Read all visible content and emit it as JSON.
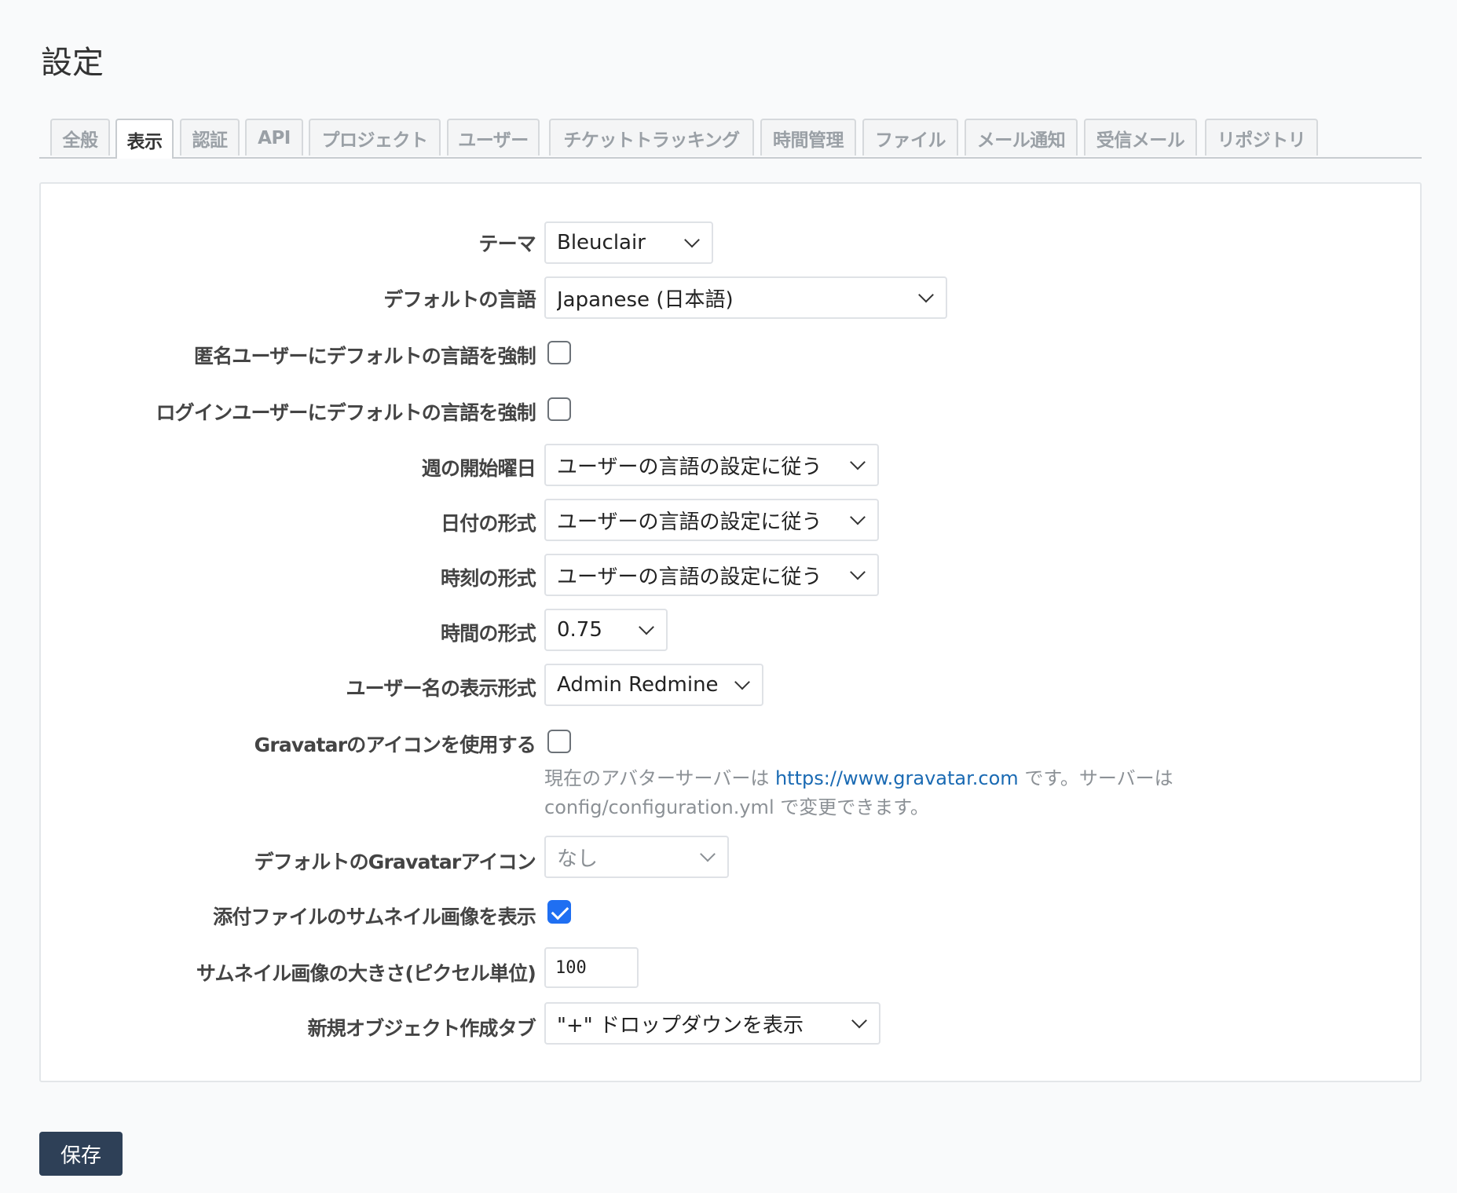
{
  "page": {
    "title": "設定"
  },
  "tabs": [
    {
      "label": "全般",
      "selected": false
    },
    {
      "label": "表示",
      "selected": true
    },
    {
      "label": "認証",
      "selected": false
    },
    {
      "label": "API",
      "selected": false
    },
    {
      "label": "プロジェクト",
      "selected": false
    },
    {
      "label": "ユーザー",
      "selected": false
    },
    {
      "label": "チケットトラッキング",
      "selected": false
    },
    {
      "label": "時間管理",
      "selected": false
    },
    {
      "label": "ファイル",
      "selected": false
    },
    {
      "label": "メール通知",
      "selected": false
    },
    {
      "label": "受信メール",
      "selected": false
    },
    {
      "label": "リポジトリ",
      "selected": false
    }
  ],
  "form": {
    "theme": {
      "label": "テーマ",
      "value": "Bleuclair"
    },
    "default_language": {
      "label": "デフォルトの言語",
      "value": "Japanese (日本語)"
    },
    "force_default_language_anonymous": {
      "label": "匿名ユーザーにデフォルトの言語を強制",
      "checked": false
    },
    "force_default_language_logged_in": {
      "label": "ログインユーザーにデフォルトの言語を強制",
      "checked": false
    },
    "start_of_week": {
      "label": "週の開始曜日",
      "value": "ユーザーの言語の設定に従う"
    },
    "date_format": {
      "label": "日付の形式",
      "value": "ユーザーの言語の設定に従う"
    },
    "time_format": {
      "label": "時刻の形式",
      "value": "ユーザーの言語の設定に従う"
    },
    "timespan_format": {
      "label": "時間の形式",
      "value": "0.75"
    },
    "user_format": {
      "label": "ユーザー名の表示形式",
      "value": "Admin Redmine"
    },
    "gravatar_enabled": {
      "label": "Gravatarのアイコンを使用する",
      "checked": false,
      "hint_before": "現在のアバターサーバーは ",
      "hint_link": "https://www.gravatar.com",
      "hint_after": " です。サーバーは config/configuration.yml で変更できます。"
    },
    "gravatar_default": {
      "label": "デフォルトのGravatarアイコン",
      "value": "なし"
    },
    "thumbnails_enabled": {
      "label": "添付ファイルのサムネイル画像を表示",
      "checked": true
    },
    "thumbnails_size": {
      "label": "サムネイル画像の大きさ(ピクセル単位)",
      "value": "100"
    },
    "new_item_menu_tab": {
      "label": "新規オブジェクト作成タブ",
      "value": "\"+\" ドロップダウンを表示"
    }
  },
  "actions": {
    "save_label": "保存"
  },
  "colors": {
    "primary_button": "#2e4057",
    "checkbox_checked": "#1f6ff2",
    "link": "#1a6ab3"
  }
}
